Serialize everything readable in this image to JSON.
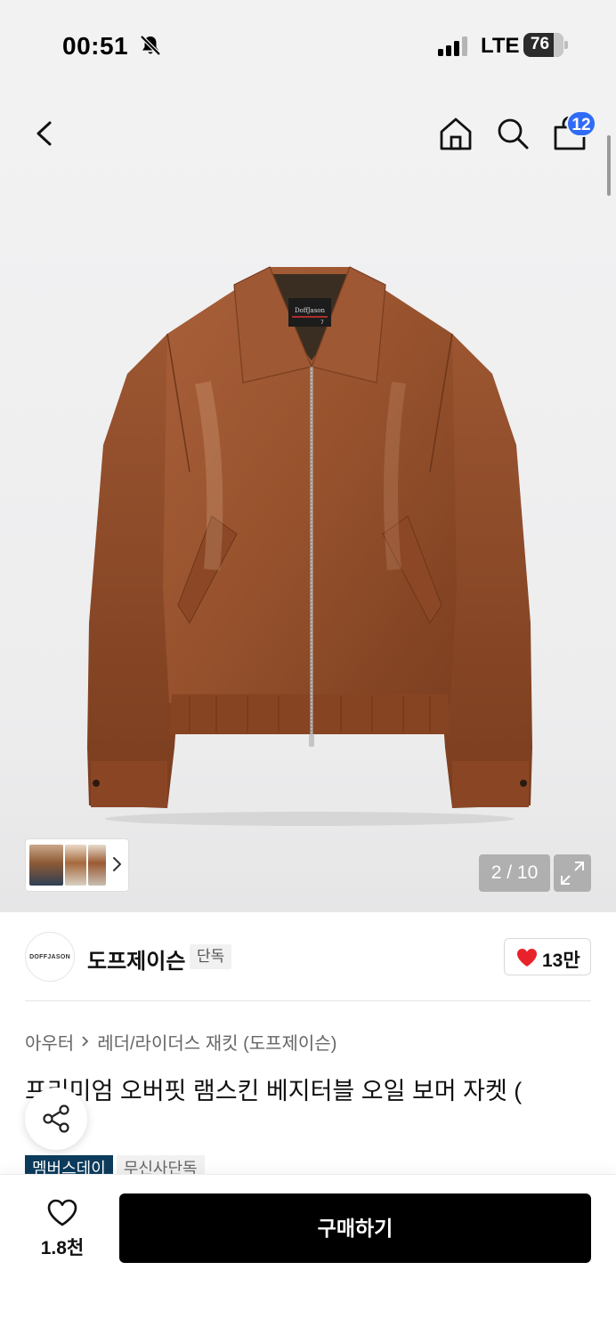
{
  "status_bar": {
    "time": "00:51",
    "network": "LTE",
    "battery": "76"
  },
  "header": {
    "cart_count": "12"
  },
  "gallery": {
    "counter": "2 / 10"
  },
  "brand": {
    "logo_text": "DOFFJASON",
    "name": "도프제이슨",
    "badge": "단독",
    "likes": "13만"
  },
  "product": {
    "breadcrumb": [
      "아우터",
      "레더/라이더스 재킷 (도프제이슨)"
    ],
    "title": "프리미엄 오버핏 램스킨 베지터블 오일 보머 자켓 (",
    "title_line2": "",
    "tags": [
      "멤버스데이",
      "무신사단독"
    ]
  },
  "jacket_label": {
    "brand": "DoffJason",
    "size": "7"
  },
  "bottom_bar": {
    "wish_count": "1.8천",
    "buy_label": "구매하기"
  },
  "colors": {
    "accent_badge": "#2f6bf6",
    "heart": "#e8222a",
    "buy_button": "#000000",
    "tag_dark": "#0c3b5c",
    "jacket_leather": "#9a5530"
  }
}
